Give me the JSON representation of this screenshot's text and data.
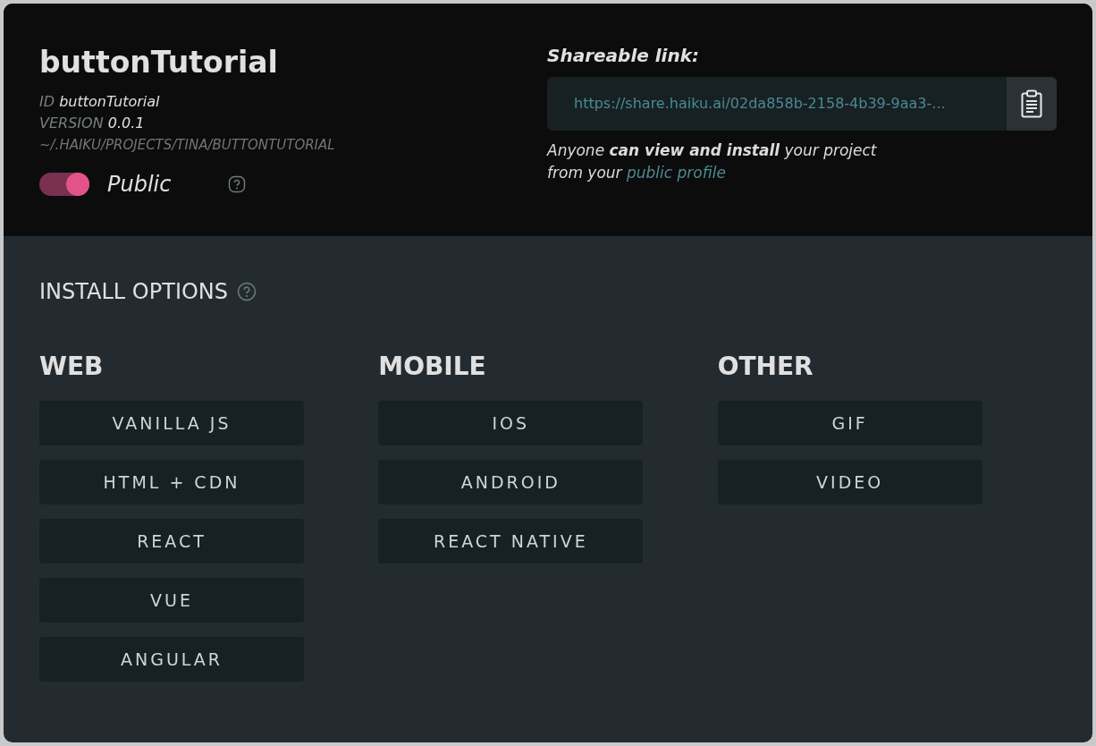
{
  "project": {
    "title": "buttonTutorial",
    "id_label": "ID",
    "id_value": "buttonTutorial",
    "version_label": "VERSION",
    "version_value": "0.0.1",
    "path": "~/.HAIKU/PROJECTS/TINA/BUTTONTUTORIAL",
    "public_toggle": {
      "label": "Public",
      "on": true
    }
  },
  "share": {
    "heading": "Shareable link:",
    "url": "https://share.haiku.ai/02da858b-2158-4b39-9aa3-...",
    "note_line_1": "Anyone **can view and install** your project",
    "note_line_2": "from your",
    "note_link": "public profile"
  },
  "install": {
    "heading": "INSTALL OPTIONS",
    "groups": [
      {
        "title": "WEB",
        "buttons": [
          "VANILLA JS",
          "HTML + CDN",
          "REACT",
          "VUE",
          "ANGULAR"
        ]
      },
      {
        "title": "MOBILE",
        "buttons": [
          "IOS",
          "ANDROID",
          "REACT NATIVE"
        ]
      },
      {
        "title": "OTHER",
        "buttons": [
          "GIF",
          "VIDEO"
        ]
      }
    ]
  }
}
